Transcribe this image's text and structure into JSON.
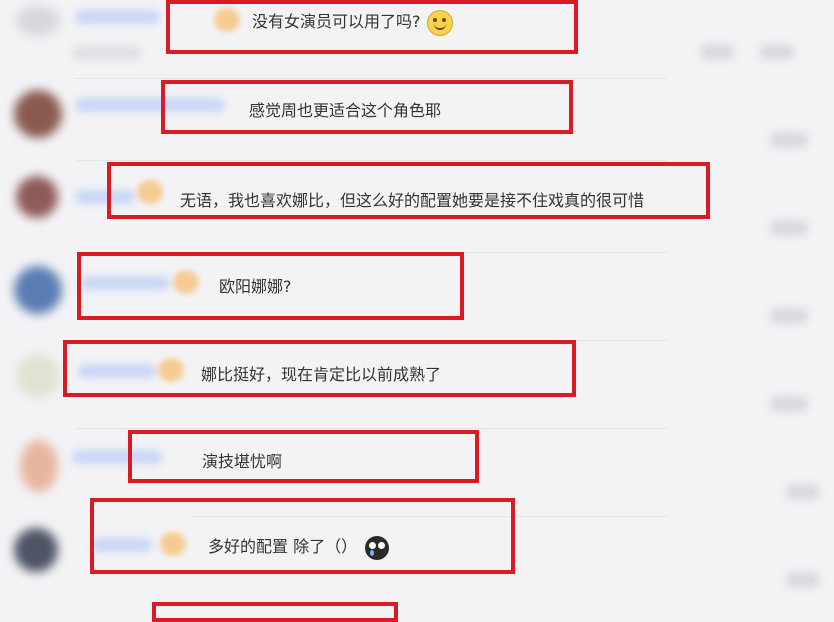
{
  "comments": [
    {
      "text": "没有女演员可以用了吗?",
      "emoji": "smile-face-icon"
    },
    {
      "text": "感觉周也更适合这个角色耶"
    },
    {
      "text": "无语，我也喜欢娜比，但这么好的配置她要是接不住戏真的很可惜"
    },
    {
      "text": "欧阳娜娜?"
    },
    {
      "text": "娜比挺好，现在肯定比以前成熟了"
    },
    {
      "text": "演技堪忧啊"
    },
    {
      "text": "多好的配置 除了（）",
      "emoji": "crying-face-icon"
    }
  ],
  "colors": {
    "background": "#f3f3f6",
    "highlight": "#d81b25",
    "text": "#333333"
  }
}
